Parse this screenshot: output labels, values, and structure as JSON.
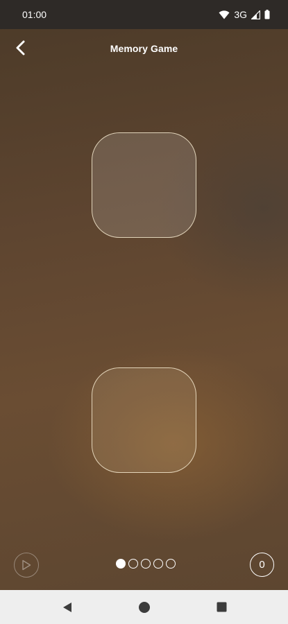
{
  "status_bar": {
    "time": "01:00",
    "network": "3G",
    "icons": [
      "wifi-icon",
      "signal-icon",
      "battery-icon"
    ]
  },
  "header": {
    "title": "Memory Game",
    "back_icon": "chevron-left-icon"
  },
  "cards": [
    {
      "state": "face-down"
    },
    {
      "state": "face-down"
    }
  ],
  "footer": {
    "play_icon": "play-icon",
    "pager": {
      "total": 5,
      "active_index": 0
    },
    "score": "0"
  },
  "nav_bar": {
    "icons": [
      "back-triangle-icon",
      "home-circle-icon",
      "recents-square-icon"
    ]
  },
  "colors": {
    "status_bar_bg": "#2e2a27",
    "card_border": "#eee2c8",
    "nav_bar_bg": "#eeeeee",
    "nav_icon": "#3c3c3c"
  }
}
